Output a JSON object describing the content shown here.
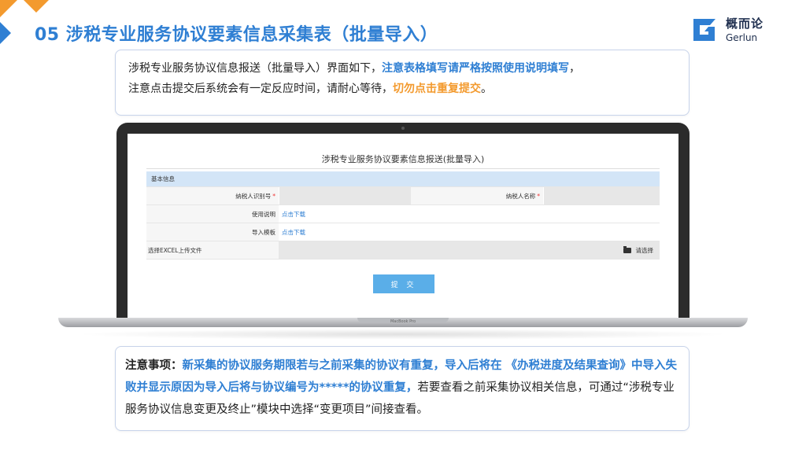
{
  "slide": {
    "title": "05 涉税专业服务协议要素信息采集表（批量导入）"
  },
  "logo": {
    "cn": "概而论",
    "en": "Gerlun"
  },
  "note_top": {
    "line1_plain": "涉税专业服务协议信息报送（批量导入）界面如下，",
    "line1_highlight": "注意表格填写请严格按照使用说明填写",
    "line1_end": "，",
    "line2_plain": "注意点击提交后系统会有一定反应时间，请耐心等待，",
    "line2_highlight": "切勿点击重复提交",
    "line2_end": "。"
  },
  "form": {
    "title": "涉税专业服务协议要素信息报送(批量导入)",
    "section_label": "基本信息",
    "taxpayer_id_label": "纳税人识别号",
    "taxpayer_name_label": "纳税人名称",
    "required_mark": "*",
    "usage_label": "使用说明",
    "usage_link": "点击下载",
    "template_label": "导入模板",
    "template_link": "点击下载",
    "upload_label": "选择EXCEL上传文件",
    "picker_label": "请选择",
    "submit_label": "提 交"
  },
  "laptop": {
    "brand": "MacBook Pro"
  },
  "note_bottom": {
    "prefix": "注意事项：",
    "highlight": "新采集的协议服务期限若与之前采集的协议有重复，导入后将在 《办税进度及结果查询》中导入失败并显示原因为导入后将与协议编号为*****的协议重复，",
    "rest": "若要查看之前采集协议相关信息，可通过“涉税专业服务协议信息变更及终止”模块中选择“变更项目”间接查看。"
  },
  "colors": {
    "brand_blue": "#2f7fd3",
    "accent_orange": "#f39a2e"
  }
}
